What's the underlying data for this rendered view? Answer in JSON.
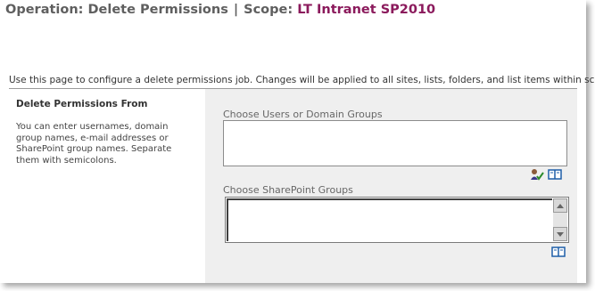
{
  "header": {
    "operation_label": "Operation: Delete Permissions",
    "separator": "|",
    "scope_label": "Scope:",
    "scope_value": "LT Intranet SP2010"
  },
  "description": "Use this page to configure a delete permissions job. Changes will be applied to all sites, lists, folders, and list items within scope.",
  "section": {
    "title": "Delete Permissions From",
    "help": "You can enter usernames, domain group names, e-mail addresses or SharePoint group names. Separate them with semicolons."
  },
  "fields": {
    "users_label": "Choose Users or Domain Groups",
    "users_value": "",
    "groups_label": "Choose SharePoint Groups",
    "groups_value": ""
  },
  "icons": {
    "check_names": "check-names-icon",
    "browse": "address-book-icon"
  },
  "colors": {
    "scope_value": "#8b1a5c",
    "panel_bg": "#efefef"
  }
}
